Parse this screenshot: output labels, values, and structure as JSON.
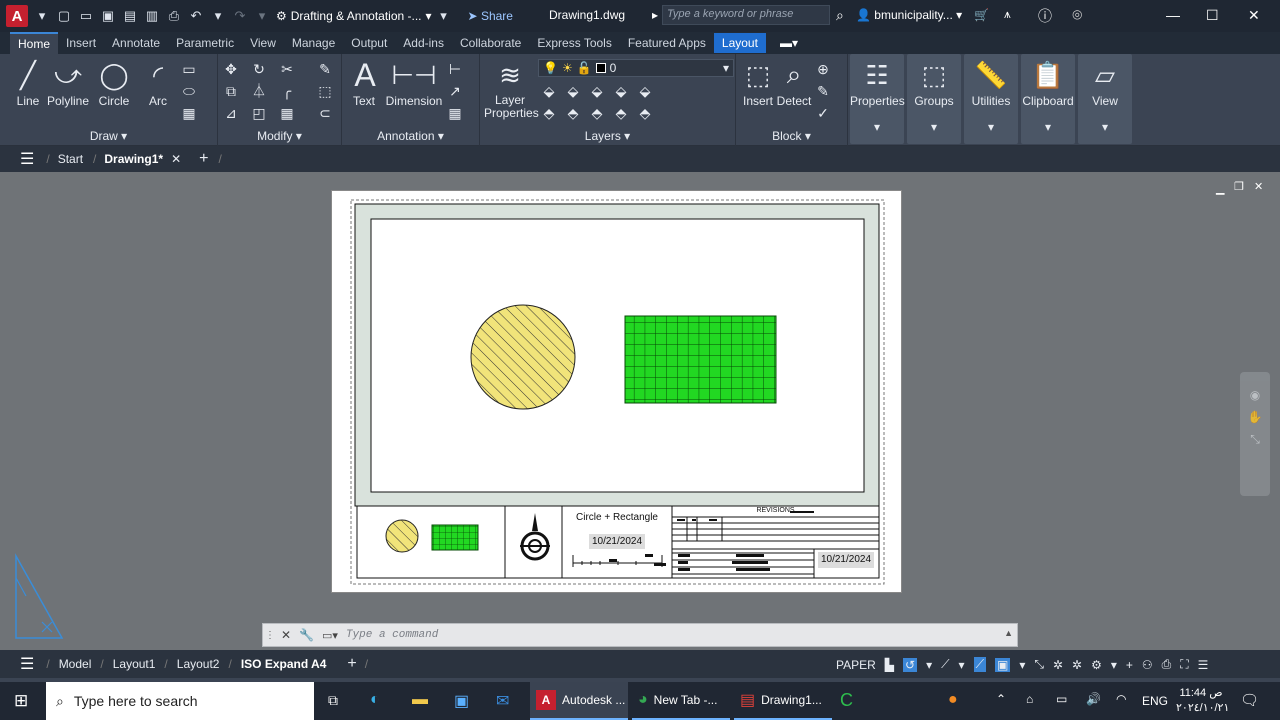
{
  "titlebar": {
    "workspace": "Drafting & Annotation -...",
    "share": "Share",
    "filename": "Drawing1.dwg",
    "search_placeholder": "Type a keyword or phrase",
    "user": "bmunicipality..."
  },
  "ribbon_tabs": [
    "Home",
    "Insert",
    "Annotate",
    "Parametric",
    "View",
    "Manage",
    "Output",
    "Add-ins",
    "Collaborate",
    "Express Tools",
    "Featured Apps",
    "Layout"
  ],
  "ribbon": {
    "draw": {
      "title": "Draw",
      "line": "Line",
      "polyline": "Polyline",
      "circle": "Circle",
      "arc": "Arc"
    },
    "modify": {
      "title": "Modify"
    },
    "annotation": {
      "title": "Annotation",
      "text": "Text",
      "dimension": "Dimension"
    },
    "layers": {
      "title": "Layers",
      "layer_props": "Layer Properties",
      "current_layer": "0"
    },
    "block": {
      "title": "Block",
      "insert": "Insert",
      "detect": "Detect"
    },
    "properties": "Properties",
    "groups": "Groups",
    "utilities": "Utilities",
    "clipboard": "Clipboard",
    "view": "View"
  },
  "file_tabs": {
    "start": "Start",
    "drawing": "Drawing1*"
  },
  "titleblock": {
    "title": "Circle + Rectangle",
    "date1": "10/21/2024",
    "revisions": "REVISIONS",
    "date2": "10/21/2024"
  },
  "command": {
    "placeholder": "Type a command"
  },
  "layout_tabs": [
    "Model",
    "Layout1",
    "Layout2",
    "ISO Expand A4"
  ],
  "status": {
    "paper": "PAPER"
  },
  "taskbar": {
    "search": "Type here to search",
    "apps": [
      "Autodesk ...",
      "New Tab -...",
      "Drawing1..."
    ],
    "lang": "ENG",
    "time": "11:44 ص",
    "date": "٢٠٢٤/١٠/٢١"
  },
  "colors": {
    "accent": "#1f6dcf",
    "circle_fill": "#f1e47a",
    "rect_fill": "#22d822",
    "paper_band": "#d9e2dc"
  }
}
